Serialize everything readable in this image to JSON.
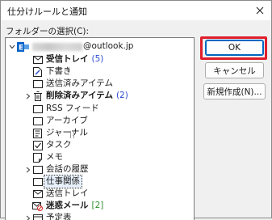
{
  "dialog": {
    "title": "仕分けルールと通知",
    "folder_label": "フォルダーの選択(C):"
  },
  "account": {
    "name_suffix": "@outlook.jp"
  },
  "folders": [
    {
      "label": "受信トレイ",
      "count": "(5)",
      "icon": "inbox-icon"
    },
    {
      "label": "下書き",
      "icon": "drafts-icon"
    },
    {
      "label": "送信済みアイテム",
      "icon": "sent-items-icon"
    },
    {
      "label": "削除済みアイテム",
      "count": "(2)",
      "icon": "trash-icon"
    },
    {
      "label": "RSS フィード",
      "icon": "rss-icon"
    },
    {
      "label": "アーカイブ",
      "icon": "archive-icon"
    },
    {
      "label": "ジャーナル",
      "icon": "journal-icon"
    },
    {
      "label": "タスク",
      "icon": "task-icon"
    },
    {
      "label": "メモ",
      "icon": "note-icon"
    },
    {
      "label": "会話の履歴",
      "icon": "folder-icon"
    },
    {
      "label": "仕事関係",
      "icon": "folder-icon"
    },
    {
      "label": "送信トレイ",
      "icon": "outbox-icon"
    },
    {
      "label": "迷惑メール",
      "count": "[2]",
      "icon": "junk-icon"
    },
    {
      "label": "予定表",
      "icon": "calendar-icon"
    }
  ],
  "buttons": {
    "ok": "OK",
    "cancel": "キャンセル",
    "new_folder": "新規作成(N)..."
  },
  "colors": {
    "highlight_outline": "#e01e2b",
    "count_blue": "#2a4bd0",
    "count_green": "#2f8f2f",
    "account_icon": "#0a64c8"
  }
}
